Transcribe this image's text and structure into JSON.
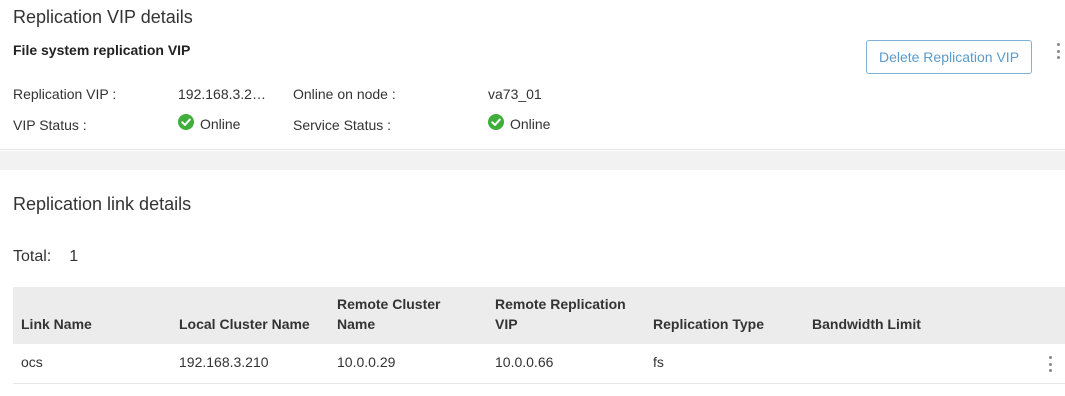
{
  "vip_section": {
    "title": "Replication VIP details",
    "subtitle": "File system replication VIP",
    "delete_button": "Delete Replication VIP",
    "replication_vip_label": "Replication VIP :",
    "replication_vip_value": "192.168.3.2…",
    "online_node_label": "Online on node :",
    "online_node_value": "va73_01",
    "vip_status_label": "VIP Status :",
    "vip_status_value": "Online",
    "service_status_label": "Service Status :",
    "service_status_value": "Online",
    "status_icon": "check-circle-icon",
    "status_color": "#3fae3b"
  },
  "link_section": {
    "title": "Replication link details",
    "total_label": "Total:",
    "total_value": "1",
    "columns": [
      "Link Name",
      "Local Cluster Name",
      "Remote Cluster Name",
      "Remote Replication VIP",
      "Replication Type",
      "Bandwidth Limit"
    ],
    "rows": [
      {
        "link_name": "ocs",
        "local_cluster": "192.168.3.210",
        "remote_cluster": "10.0.0.29",
        "remote_vip": "10.0.0.66",
        "type": "fs",
        "bandwidth": ""
      }
    ]
  },
  "colors": {
    "accent": "#5a9bc9",
    "header_bg": "#ececec",
    "gap_bg": "#f2f2f2"
  }
}
